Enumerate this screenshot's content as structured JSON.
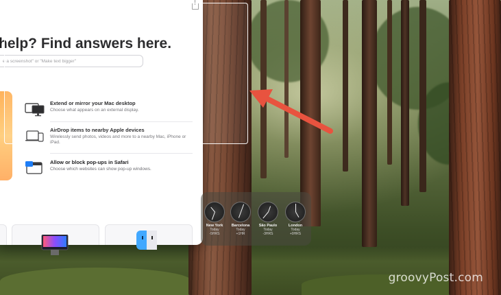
{
  "help_window": {
    "title": "help? Find answers here.",
    "search_placeholder": "e a screenshot\" or \"Make text bigger\"",
    "rows": [
      {
        "title": "Extend or mirror your Mac desktop",
        "description": "Choose what appears on an external display.",
        "icon": "display-icon"
      },
      {
        "title": "AirDrop items to nearby Apple devices",
        "description": "Wirelessly send photos, videos and more to a nearby Mac, iPhone or iPad.",
        "icon": "airdrop-devices-icon"
      },
      {
        "title": "Allow or block pop-ups in Safari",
        "description": "Choose which websites can show pop-up windows.",
        "icon": "popup-window-icon"
      }
    ]
  },
  "world_clock": {
    "clocks": [
      {
        "city": "New York",
        "day": "Today",
        "offset": "-5HRS"
      },
      {
        "city": "Barcelona",
        "day": "Today",
        "offset": "+1HR"
      },
      {
        "city": "São Paulo",
        "day": "Today",
        "offset": "-3HRS"
      },
      {
        "city": "London",
        "day": "Today",
        "offset": "+0HRS"
      }
    ]
  },
  "watermark": "groovyPost.com",
  "colors": {
    "arrow": "#e8533f",
    "selection_border": "#ffffff",
    "orange_panel": "#ffb25b"
  }
}
